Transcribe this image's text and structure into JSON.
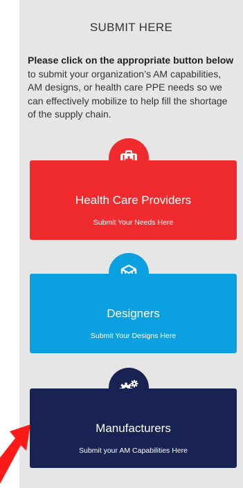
{
  "heading": "SUBMIT HERE",
  "intro": {
    "bold": "Please click on the appropriate button below",
    "rest": " to submit your organization’s AM capabilities, AM designs, or  health care PPE needs so we can effectively mobilize to help fill the shortage of the supply chain."
  },
  "cards": [
    {
      "title": "Health Care Providers",
      "subtitle": "Submit Your Needs Here",
      "icon": "first-aid-kit-icon",
      "color": "#ef2b2d"
    },
    {
      "title": "Designers",
      "subtitle": "Submit Your Designs Here",
      "icon": "cube-design-icon",
      "color": "#0ba0e0"
    },
    {
      "title": "Manufacturers",
      "subtitle": "Submit your AM Capabilities Here",
      "icon": "gears-icon",
      "color": "#182353"
    }
  ],
  "annotation": {
    "arrow_color": "#ff1a1a"
  }
}
